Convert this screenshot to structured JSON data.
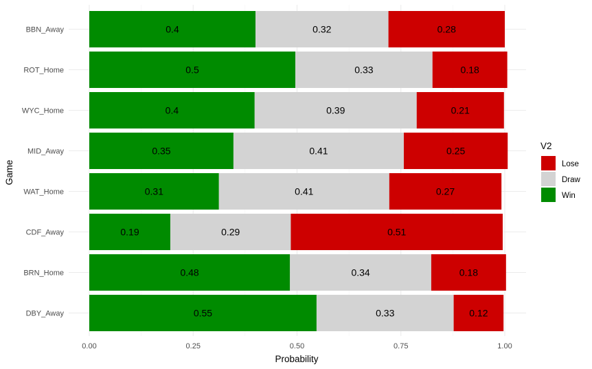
{
  "chart_data": {
    "type": "bar",
    "orientation": "horizontal",
    "stacked": true,
    "title": "",
    "xlabel": "Probability",
    "ylabel": "Game",
    "xlim": [
      0,
      1
    ],
    "x_ticks": [
      "0.00",
      "0.25",
      "0.50",
      "0.75",
      "1.00"
    ],
    "x_tick_values": [
      0,
      0.25,
      0.5,
      0.75,
      1.0
    ],
    "grid": true,
    "categories": [
      "BBN_Away",
      "ROT_Home",
      "WYC_Home",
      "MID_Away",
      "WAT_Home",
      "CDF_Away",
      "BRN_Home",
      "DBY_Away"
    ],
    "series": [
      {
        "name": "Win",
        "color": "#008B00",
        "values": [
          0.4,
          0.496,
          0.398,
          0.347,
          0.312,
          0.195,
          0.483,
          0.547
        ],
        "labels": [
          "0.4",
          "0.5",
          "0.4",
          "0.35",
          "0.31",
          "0.19",
          "0.48",
          "0.55"
        ]
      },
      {
        "name": "Draw",
        "color": "#D3D3D3",
        "values": [
          0.32,
          0.33,
          0.39,
          0.41,
          0.41,
          0.29,
          0.34,
          0.33
        ],
        "labels": [
          "0.32",
          "0.33",
          "0.39",
          "0.41",
          "0.41",
          "0.29",
          "0.34",
          "0.33"
        ]
      },
      {
        "name": "Lose",
        "color": "#CD0000",
        "values": [
          0.28,
          0.18,
          0.21,
          0.25,
          0.27,
          0.51,
          0.18,
          0.12
        ],
        "labels": [
          "0.28",
          "0.18",
          "0.21",
          "0.25",
          "0.27",
          "0.51",
          "0.18",
          "0.12"
        ]
      }
    ],
    "legend": {
      "title": "V2",
      "position": "right",
      "entries": [
        {
          "label": "Lose",
          "color": "#CD0000"
        },
        {
          "label": "Draw",
          "color": "#D3D3D3"
        },
        {
          "label": "Win",
          "color": "#008B00"
        }
      ]
    }
  }
}
